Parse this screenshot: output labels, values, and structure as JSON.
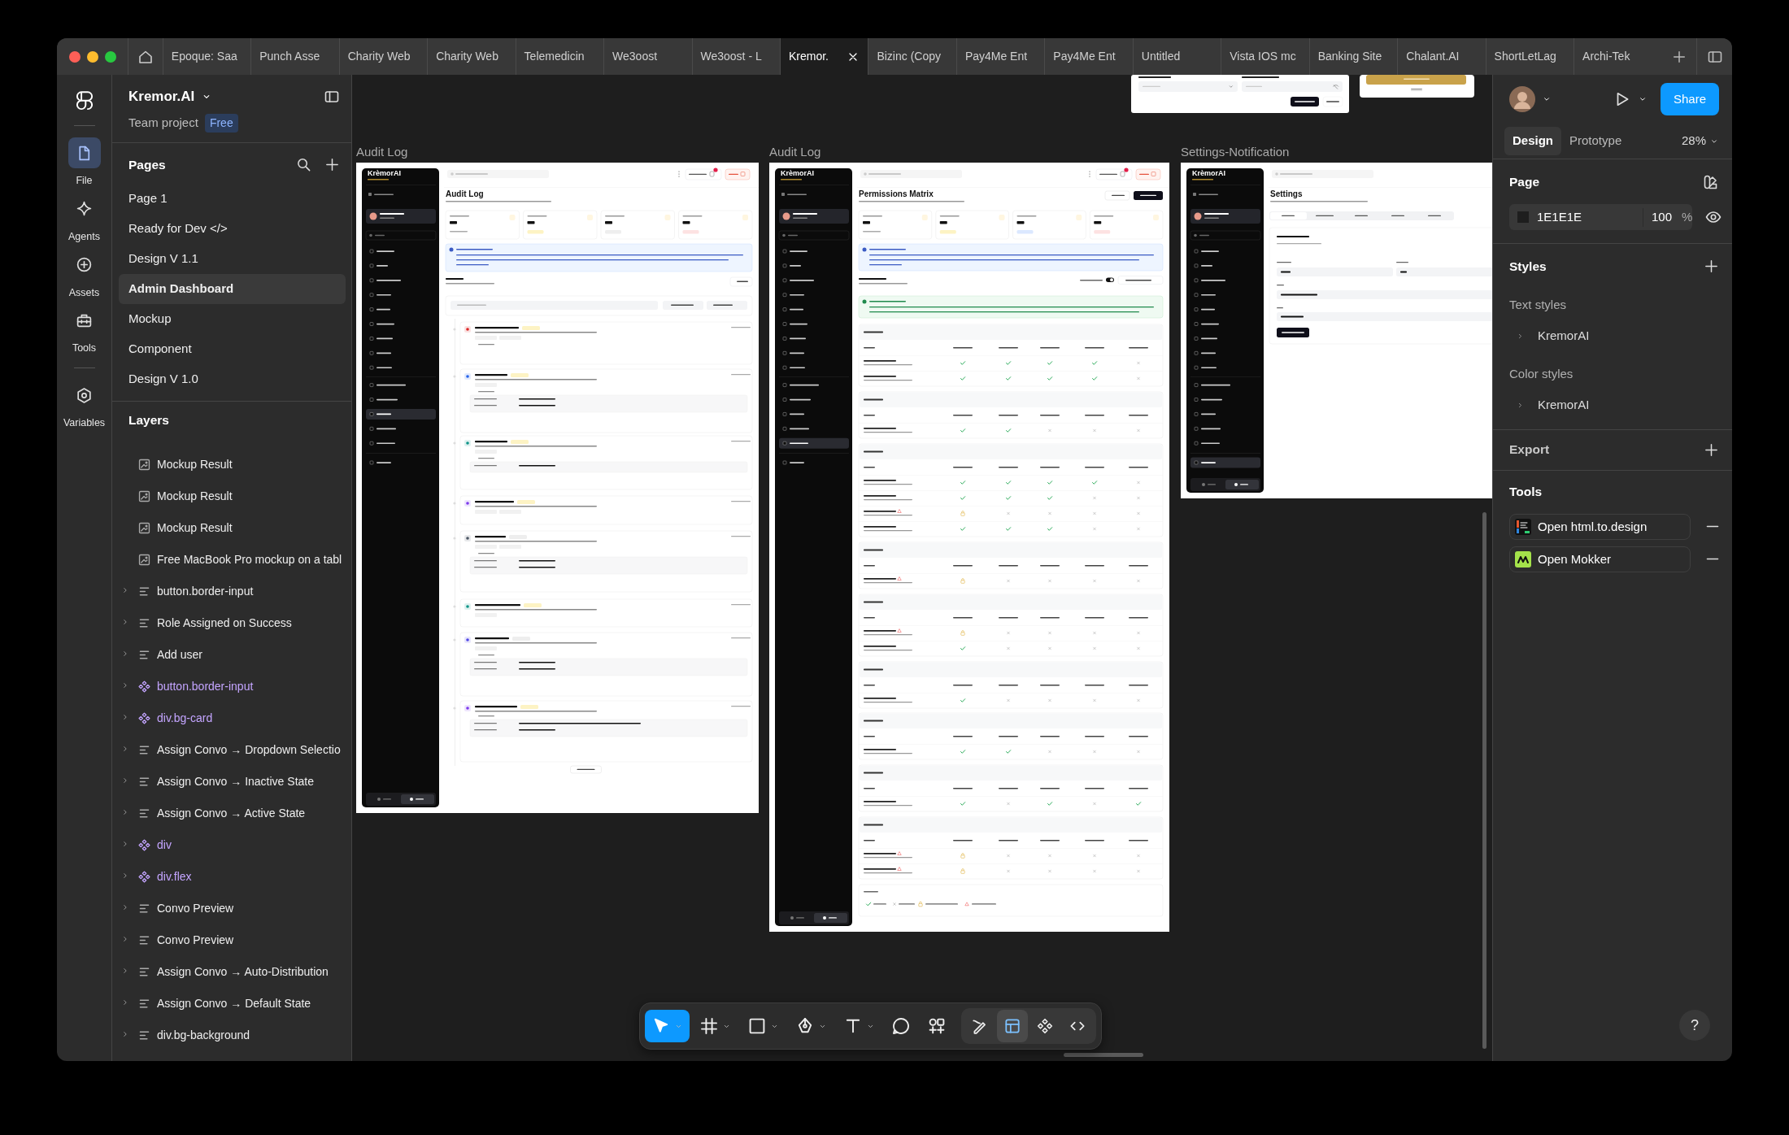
{
  "browser_tabs": [
    {
      "label": "Epoque: Saa",
      "selected": false
    },
    {
      "label": "Punch Asse",
      "selected": false
    },
    {
      "label": "Charity Web",
      "selected": false
    },
    {
      "label": "Charity Web",
      "selected": false
    },
    {
      "label": "Telemedicin",
      "selected": false
    },
    {
      "label": "We3oost",
      "selected": false
    },
    {
      "label": "We3oost - L",
      "selected": false
    },
    {
      "label": "Kremor.",
      "selected": true
    },
    {
      "label": "Bizinc (Copy",
      "selected": false
    },
    {
      "label": "Pay4Me Ent",
      "selected": false
    },
    {
      "label": "Pay4Me Ent",
      "selected": false
    },
    {
      "label": "Untitled",
      "selected": false
    },
    {
      "label": "Vista IOS mc",
      "selected": false
    },
    {
      "label": "Banking Site",
      "selected": false
    },
    {
      "label": "Chalant.AI",
      "selected": false
    },
    {
      "label": "ShortLetLag",
      "selected": false
    },
    {
      "label": "Archi-Tek",
      "selected": false
    }
  ],
  "rail": [
    {
      "label": "File",
      "kind": "file",
      "selected": true
    },
    {
      "label": "Agents",
      "kind": "agents",
      "selected": false
    },
    {
      "label": "Assets",
      "kind": "assets",
      "selected": false
    },
    {
      "label": "Tools",
      "kind": "tools",
      "selected": false
    },
    {
      "label": "Variables",
      "kind": "variables",
      "selected": false
    }
  ],
  "file": {
    "name": "Kremor.AI",
    "project": "Team project",
    "plan": "Free"
  },
  "pages": {
    "title": "Pages",
    "items": [
      {
        "label": "Page 1",
        "selected": false
      },
      {
        "label": "Ready for Dev </>",
        "selected": false
      },
      {
        "label": "Design V 1.1",
        "selected": false
      },
      {
        "label": "Admin Dashboard",
        "selected": true
      },
      {
        "label": "Mockup",
        "selected": false
      },
      {
        "label": "Component",
        "selected": false
      },
      {
        "label": "Design V 1.0",
        "selected": false
      }
    ]
  },
  "layers": {
    "title": "Layers",
    "items": [
      {
        "label": "Mockup Result",
        "kind": "image",
        "expandable": false
      },
      {
        "label": "Mockup Result",
        "kind": "image",
        "expandable": false
      },
      {
        "label": "Mockup Result",
        "kind": "image",
        "expandable": false
      },
      {
        "label": "Free MacBook Pro mockup on a tabl",
        "kind": "image",
        "expandable": false
      },
      {
        "label": "button.border-input",
        "kind": "frame",
        "expandable": true
      },
      {
        "label": "Role Assigned on Success",
        "kind": "frame",
        "expandable": true
      },
      {
        "label": "Add user",
        "kind": "frame",
        "expandable": true
      },
      {
        "label": "button.border-input",
        "kind": "component",
        "expandable": true
      },
      {
        "label": "div.bg-card",
        "kind": "component",
        "expandable": true
      },
      {
        "label": "Assign Convo → Dropdown Selectio",
        "kind": "frame",
        "expandable": true
      },
      {
        "label": "Assign Convo → Inactive State",
        "kind": "frame",
        "expandable": true
      },
      {
        "label": "Assign Convo → Active State",
        "kind": "frame",
        "expandable": true
      },
      {
        "label": "div",
        "kind": "component",
        "expandable": true
      },
      {
        "label": "div.flex",
        "kind": "component",
        "expandable": true
      },
      {
        "label": "Convo Preview",
        "kind": "frame",
        "expandable": true
      },
      {
        "label": "Convo Preview",
        "kind": "frame",
        "expandable": true
      },
      {
        "label": "Assign Convo → Auto-Distribution",
        "kind": "frame",
        "expandable": true
      },
      {
        "label": "Assign Convo → Default State",
        "kind": "frame",
        "expandable": true
      },
      {
        "label": "div.bg-background",
        "kind": "frame",
        "expandable": true
      }
    ]
  },
  "canvas": {
    "frames": [
      {
        "label": "Audit Log",
        "kind": "audit",
        "logo": "KrèmorAI",
        "title": "Audit Log"
      },
      {
        "label": "Audit Log",
        "kind": "permissions",
        "logo": "KrèmorAI",
        "title": "Permissions Matrix"
      },
      {
        "label": "Settings-Notification",
        "kind": "settings",
        "logo": "KrèmorAI",
        "title": "Settings"
      }
    ]
  },
  "toolbar": {
    "tools": [
      {
        "kind": "move",
        "selected": true,
        "menu": true
      },
      {
        "kind": "frame",
        "selected": false,
        "menu": true
      },
      {
        "kind": "rectangle",
        "selected": false,
        "menu": true
      },
      {
        "kind": "pen",
        "selected": false,
        "menu": true
      },
      {
        "kind": "text",
        "selected": false,
        "menu": true
      },
      {
        "kind": "comment",
        "selected": false,
        "menu": false
      },
      {
        "kind": "actions",
        "selected": false,
        "menu": false
      }
    ],
    "modes": [
      {
        "kind": "draw",
        "selected": false
      },
      {
        "kind": "design",
        "selected": true
      },
      {
        "kind": "component",
        "selected": false
      },
      {
        "kind": "dev",
        "selected": false
      }
    ]
  },
  "help": "?",
  "inspector": {
    "share": "Share",
    "tabs": [
      {
        "label": "Design",
        "selected": true
      },
      {
        "label": "Prototype",
        "selected": false
      }
    ],
    "zoom": "28%",
    "page": {
      "title": "Page",
      "fill": "1E1E1E",
      "color": "#1e1e1e",
      "opacity": "100",
      "unit": "%"
    },
    "styles": {
      "title": "Styles",
      "groups": [
        {
          "title": "Text styles",
          "items": [
            "KremorAI"
          ]
        },
        {
          "title": "Color styles",
          "items": [
            "KremorAI"
          ]
        }
      ]
    },
    "export": "Export",
    "tools": {
      "title": "Tools",
      "items": [
        {
          "label": "Open html.to.design",
          "kind": "html"
        },
        {
          "label": "Open Mokker",
          "kind": "mokker"
        }
      ]
    }
  }
}
